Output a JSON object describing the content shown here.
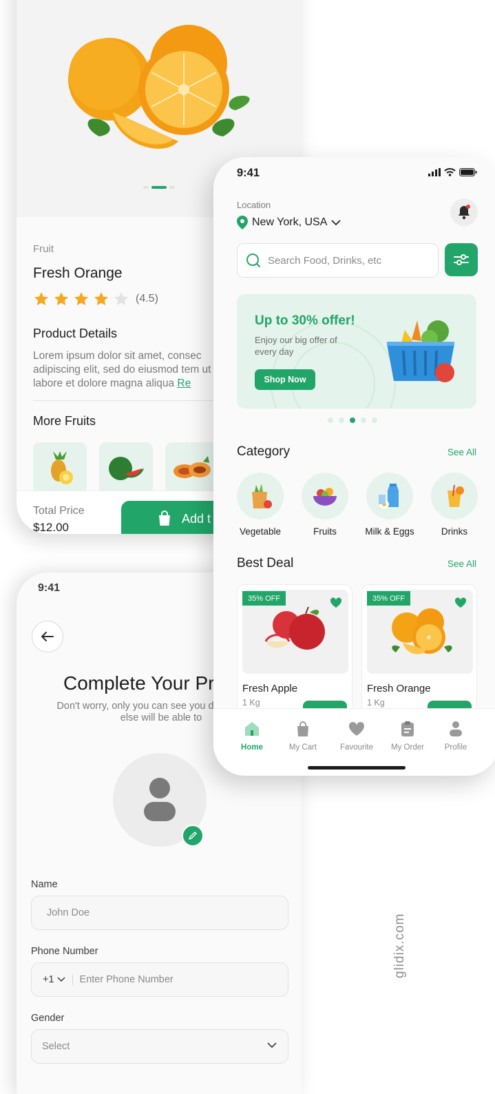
{
  "brand_color": "#21a568",
  "detail": {
    "category": "Fruit",
    "name": "Fresh Orange",
    "rating_value": 4.5,
    "rating_text": "(4.5)",
    "details_heading": "Product Details",
    "description": "Lorem ipsum dolor sit amet, consec adipiscing elit, sed do eiusmod tem ut labore et dolore magna aliqua",
    "read_more": "Re",
    "more_heading": "More Fruits",
    "total_label": "Total Price",
    "total_value": "$12.00",
    "add_label": "Add t",
    "carousel_active": 1
  },
  "home": {
    "time": "9:41",
    "location_label": "Location",
    "location_value": "New York, USA",
    "search_placeholder": "Search Food, Drinks, etc",
    "banner": {
      "title": "Up to 30% offer!",
      "subtitle": "Enjoy our big offer of every day",
      "button": "Shop Now",
      "dots_total": 5,
      "dots_active": 3
    },
    "category_title": "Category",
    "see_all": "See All",
    "categories": [
      {
        "label": "Vegetable",
        "icon": "vegetable-bag-icon"
      },
      {
        "label": "Fruits",
        "icon": "fruit-bowl-icon"
      },
      {
        "label": "Milk & Eggs",
        "icon": "milk-eggs-icon"
      },
      {
        "label": "Drinks",
        "icon": "drink-glass-icon"
      }
    ],
    "best_deal_title": "Best Deal",
    "deals": [
      {
        "badge": "35% OFF",
        "name": "Fresh Apple",
        "weight": "1 Kg",
        "icon": "apple-icon"
      },
      {
        "badge": "35% OFF",
        "name": "Fresh Orange",
        "weight": "1 Kg",
        "icon": "orange-icon"
      }
    ],
    "nav": [
      {
        "label": "Home",
        "icon": "home-icon",
        "active": true
      },
      {
        "label": "My Cart",
        "icon": "cart-bag-icon",
        "active": false
      },
      {
        "label": "Favourite",
        "icon": "heart-icon",
        "active": false
      },
      {
        "label": "My Order",
        "icon": "order-clipboard-icon",
        "active": false
      },
      {
        "label": "Profile",
        "icon": "profile-icon",
        "active": false
      }
    ]
  },
  "profile": {
    "time": "9:41",
    "title": "Complete Your Pr",
    "subtitle": "Don't worry, only you can see you data. No one else will be able to",
    "name_label": "Name",
    "name_placeholder": "John Doe",
    "phone_label": "Phone Number",
    "country_code": "+1",
    "phone_placeholder": "Enter Phone Number",
    "gender_label": "Gender",
    "gender_placeholder": "Select"
  },
  "watermark": "glidix.com"
}
